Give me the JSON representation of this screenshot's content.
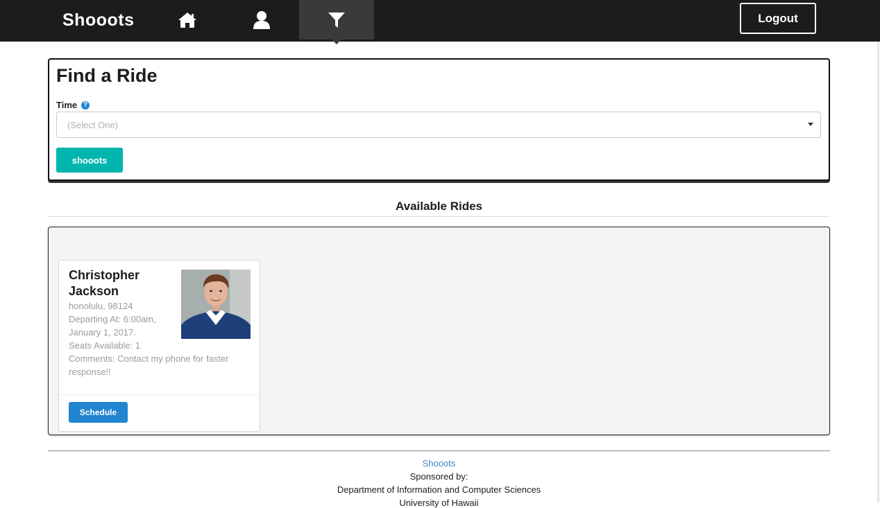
{
  "nav": {
    "brand": "Shooots",
    "items": [
      {
        "icon": "home-icon"
      },
      {
        "icon": "user-icon"
      },
      {
        "icon": "filter-icon",
        "active": true
      }
    ],
    "logout_label": "Logout"
  },
  "find": {
    "title": "Find a Ride",
    "time_label": "Time",
    "time_help_icon": "question-circle-icon",
    "select_placeholder": "(Select One)",
    "submit_label": "shooots"
  },
  "rides": {
    "title": "Available Rides",
    "cards": [
      {
        "name": "Christopher Jackson",
        "location": "honolulu, 98124",
        "departing": "Departing At: 6:00am, January 1, 2017.",
        "seats": "Seats Available: 1",
        "comments": "Comments: Contact my phone for faster response!!",
        "schedule_label": "Schedule"
      }
    ]
  },
  "footer": {
    "link": "Shooots",
    "sponsored": "Sponsored by:",
    "department": "Department of Information and Computer Sciences",
    "university": "University of Hawaii"
  },
  "colors": {
    "nav_bg": "#1b1c1d",
    "teal": "#00b5ad",
    "blue": "#2185d0",
    "rides_bg": "#f3f4f5"
  }
}
